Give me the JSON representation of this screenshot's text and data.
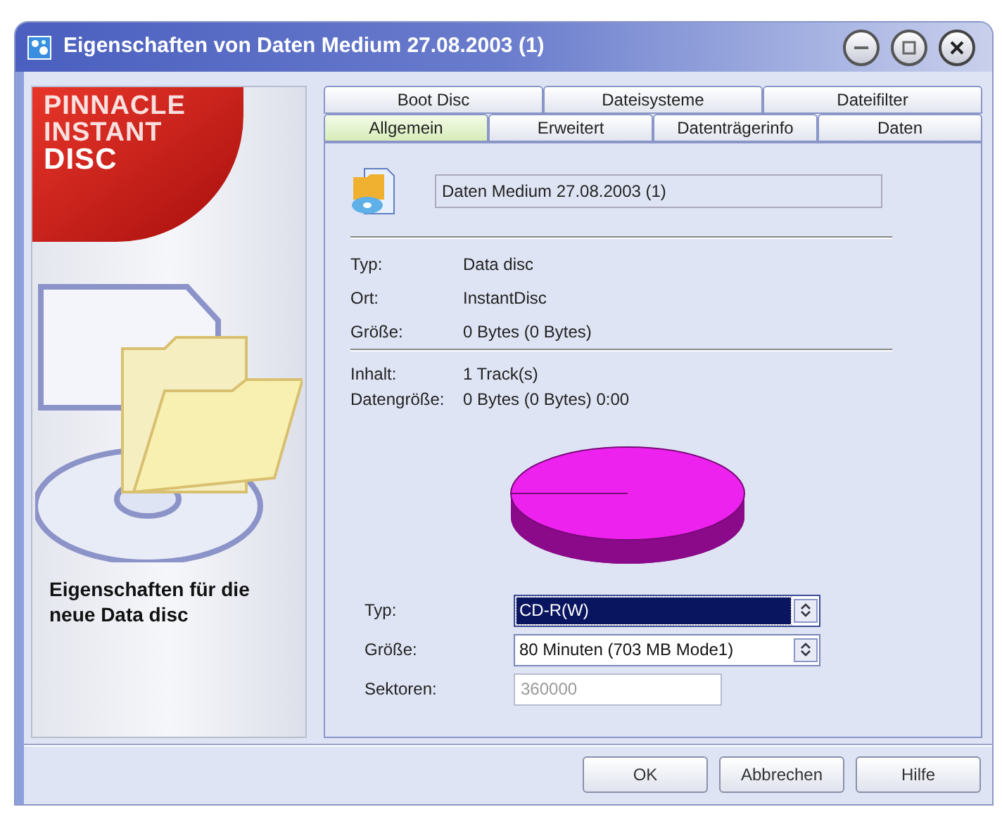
{
  "window": {
    "title": "Eigenschaften von Daten Medium 27.08.2003 (1)"
  },
  "sidebar": {
    "logo_lines": [
      "PINNACLE",
      "INSTANT",
      "DISC"
    ],
    "caption": "Eigenschaften für die neue Data disc"
  },
  "tabs": [
    [
      {
        "label": "Boot Disc",
        "selected": false
      },
      {
        "label": "Dateisysteme",
        "selected": false
      },
      {
        "label": "Dateifilter",
        "selected": false
      }
    ],
    [
      {
        "label": "Allgemein",
        "selected": true
      },
      {
        "label": "Erweitert",
        "selected": false
      },
      {
        "label": "Datenträgerinfo",
        "selected": false
      },
      {
        "label": "Daten",
        "selected": false
      }
    ]
  ],
  "name_field": {
    "value": "Daten Medium 27.08.2003 (1)"
  },
  "properties": [
    {
      "label": "Typ:",
      "value": "Data disc"
    },
    {
      "label": "Ort:",
      "value": "InstantDisc"
    },
    {
      "label": "Größe:",
      "value": "0 Bytes (0 Bytes)"
    }
  ],
  "contents": [
    {
      "label": "Inhalt:",
      "value": "1 Track(s)"
    },
    {
      "label": "Datengröße:",
      "value": "0 Bytes (0 Bytes) 0:00"
    }
  ],
  "media": [
    {
      "kind": "select",
      "label": "Typ:",
      "value": "CD-R(W)",
      "focused": true,
      "disabled": false
    },
    {
      "kind": "select",
      "label": "Größe:",
      "value": "80 Minuten (703 MB Mode1)",
      "focused": false,
      "disabled": false
    },
    {
      "kind": "text",
      "label": "Sektoren:",
      "value": "360000",
      "focused": false,
      "disabled": true
    }
  ],
  "buttons": [
    "OK",
    "Abbrechen",
    "Hilfe"
  ]
}
